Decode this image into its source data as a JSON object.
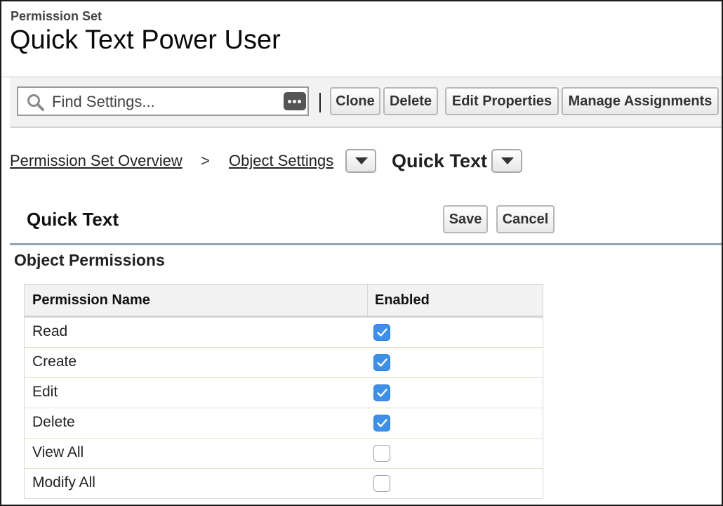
{
  "header": {
    "eyebrow": "Permission Set",
    "title": "Quick Text Power User"
  },
  "toolbar": {
    "search_placeholder": "Find Settings...",
    "clone_label": "Clone",
    "delete_label": "Delete",
    "edit_properties_label": "Edit Properties",
    "manage_assignments_label": "Manage Assignments"
  },
  "breadcrumb": {
    "overview_label": "Permission Set Overview",
    "separator": ">",
    "object_settings_label": "Object Settings",
    "current_label": "Quick Text"
  },
  "section": {
    "title": "Quick Text",
    "save_label": "Save",
    "cancel_label": "Cancel",
    "object_permissions_title": "Object Permissions"
  },
  "table": {
    "col_name": "Permission Name",
    "col_enabled": "Enabled",
    "rows": [
      {
        "name": "Read",
        "enabled": true
      },
      {
        "name": "Create",
        "enabled": true
      },
      {
        "name": "Edit",
        "enabled": true
      },
      {
        "name": "Delete",
        "enabled": true
      },
      {
        "name": "View All",
        "enabled": false
      },
      {
        "name": "Modify All",
        "enabled": false
      }
    ]
  },
  "colors": {
    "checkbox_on": "#3d8fe8",
    "section_rule": "#8fa6b8"
  },
  "icons": {
    "search": "search-icon",
    "more": "more-options-icon",
    "dropdown": "chevron-down-icon",
    "check": "check-icon"
  }
}
